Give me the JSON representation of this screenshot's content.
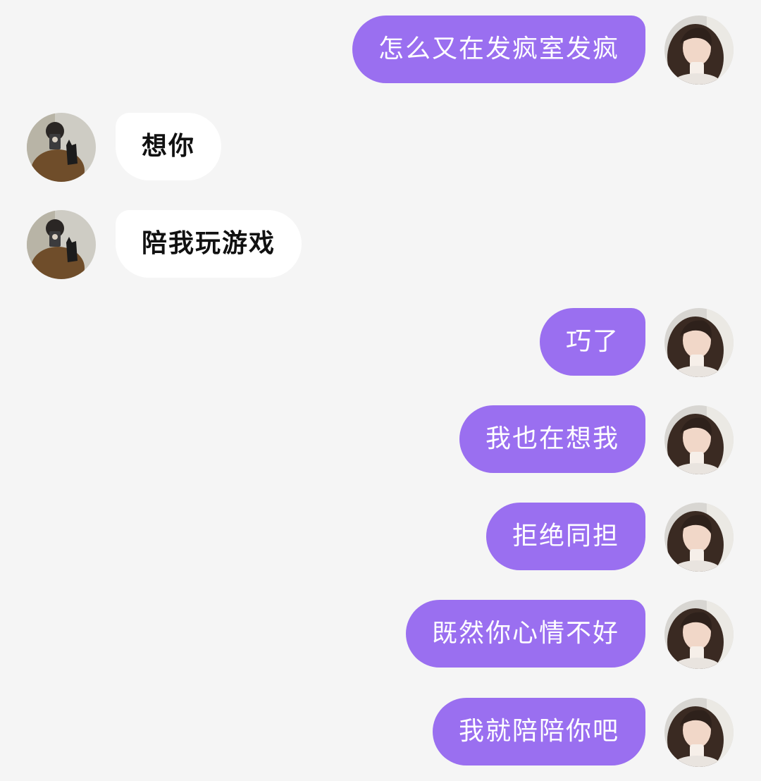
{
  "conversation": {
    "messages": [
      {
        "side": "out",
        "avatar": "female-user-avatar",
        "text": "怎么又在发疯室发疯"
      },
      {
        "side": "in",
        "avatar": "male-user-avatar",
        "text": "想你"
      },
      {
        "side": "in",
        "avatar": "male-user-avatar",
        "text": "陪我玩游戏"
      },
      {
        "side": "out",
        "avatar": "female-user-avatar",
        "text": "巧了"
      },
      {
        "side": "out",
        "avatar": "female-user-avatar",
        "text": "我也在想我"
      },
      {
        "side": "out",
        "avatar": "female-user-avatar",
        "text": "拒绝同担"
      },
      {
        "side": "out",
        "avatar": "female-user-avatar",
        "text": "既然你心情不好"
      },
      {
        "side": "out",
        "avatar": "female-user-avatar",
        "text": "我就陪陪你吧"
      }
    ]
  },
  "colors": {
    "background": "#f5f5f5",
    "outgoing_bubble": "#9a6ff0",
    "outgoing_text": "#ffffff",
    "incoming_bubble": "#ffffff",
    "incoming_text": "#111111"
  }
}
